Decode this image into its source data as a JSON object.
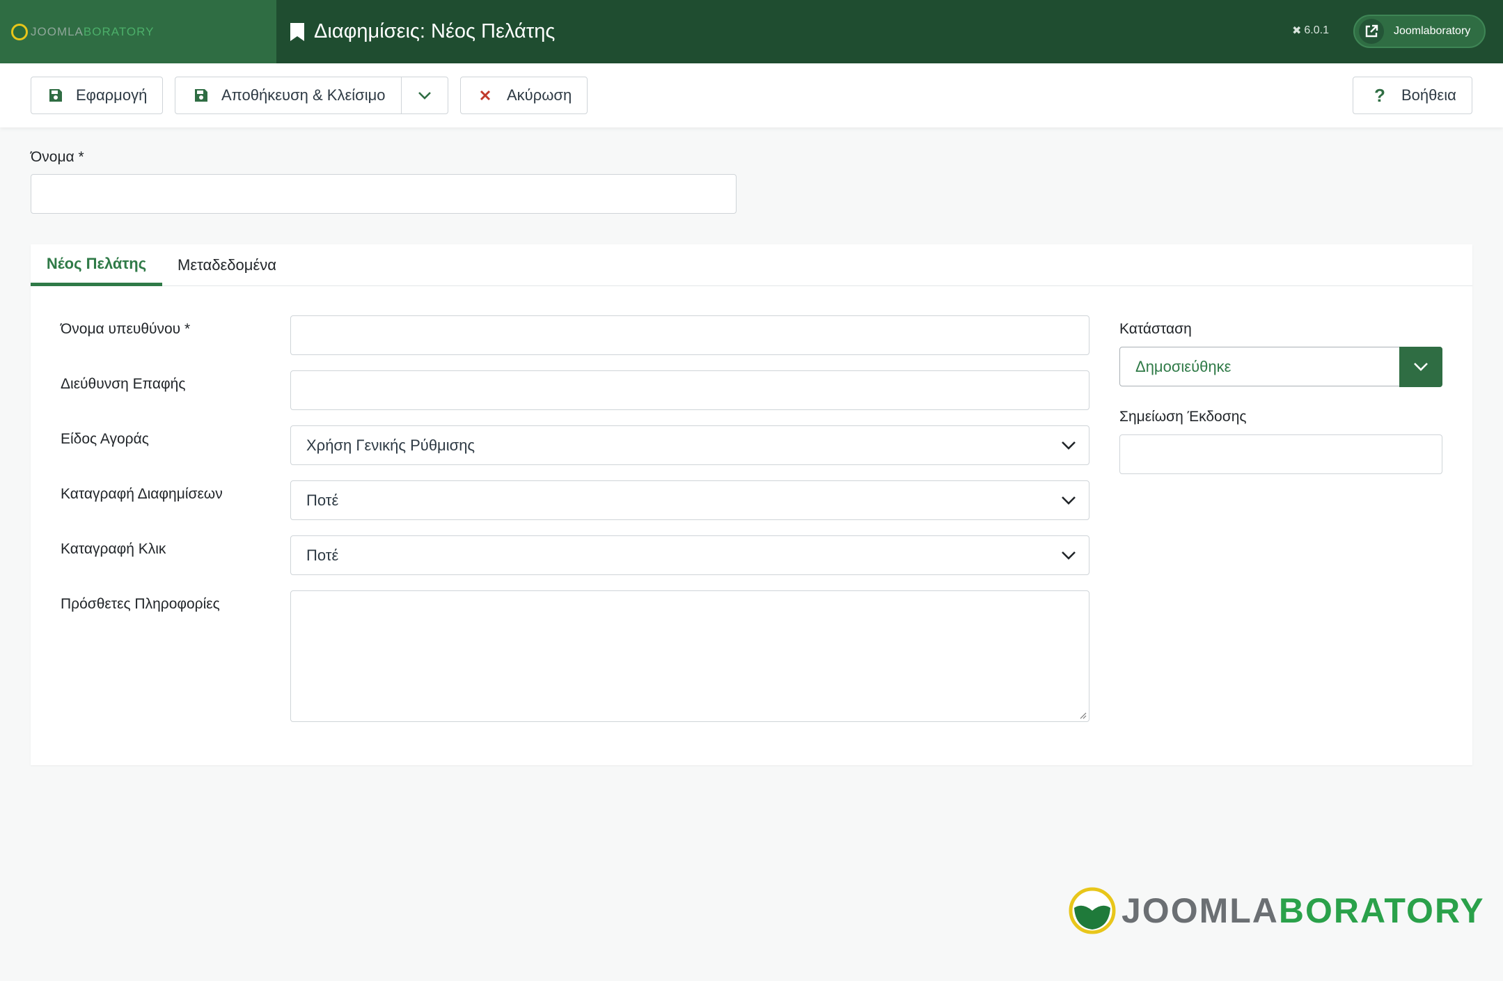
{
  "header": {
    "brand_left": "JOOMLA",
    "brand_right": "BORATORY",
    "title": "Διαφημίσεις: Νέος Πελάτης",
    "version": "6.0.1",
    "site_button": "Joomlaboratory"
  },
  "toolbar": {
    "apply_label": "Εφαρμογή",
    "save_close_label": "Αποθήκευση & Κλείσιμο",
    "cancel_label": "Ακύρωση",
    "help_label": "Βοήθεια"
  },
  "name_field": {
    "label": "Όνομα *",
    "value": ""
  },
  "tabs": [
    {
      "label": "Νέος Πελάτης",
      "active": true
    },
    {
      "label": "Μεταδεδομένα",
      "active": false
    }
  ],
  "form": {
    "contact_name": {
      "label": "Όνομα υπευθύνου *",
      "value": ""
    },
    "contact_email": {
      "label": "Διεύθυνση Επαφής",
      "value": ""
    },
    "purchase_type": {
      "label": "Είδος Αγοράς",
      "value": "Χρήση Γενικής Ρύθμισης"
    },
    "track_impressions": {
      "label": "Καταγραφή Διαφημίσεων",
      "value": "Ποτέ"
    },
    "track_clicks": {
      "label": "Καταγραφή Κλικ",
      "value": "Ποτέ"
    },
    "extra_info": {
      "label": "Πρόσθετες Πληροφορίες",
      "value": ""
    }
  },
  "sidebar": {
    "status": {
      "label": "Κατάσταση",
      "value": "Δημοσιεύθηκε"
    },
    "version_note": {
      "label": "Σημείωση Έκδοσης",
      "value": ""
    }
  },
  "footer": {
    "logo_left": "JOOMLA",
    "logo_right": "BORATORY"
  },
  "colors": {
    "header_bg": "#1f4d30",
    "accent": "#2f7a47",
    "danger": "#c0392b"
  }
}
